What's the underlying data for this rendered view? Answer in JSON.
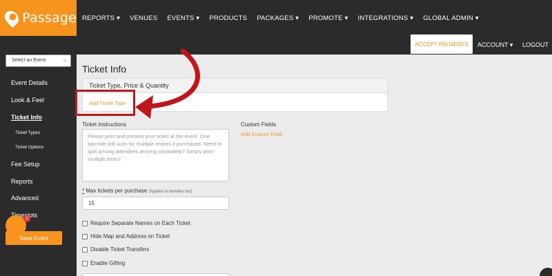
{
  "brand": {
    "name": "Passage",
    "color": "#f7941d"
  },
  "nav": [
    "REPORTS ▾",
    "VENUES",
    "EVENTS ▾",
    "PRODUCTS",
    "PACKAGES ▾",
    "PROMOTE ▾",
    "INTEGRATIONS ▾",
    "GLOBAL ADMIN ▾"
  ],
  "topright": {
    "accept": "ACCEPT PAYMENTS",
    "account": "ACCOUNT ▾",
    "logout": "LOGOUT"
  },
  "sidebar": {
    "select_placeholder": "Select an Event",
    "items": [
      "Event Details",
      "Look & Feel",
      "Ticket Info",
      "Ticket Types",
      "Ticket Options",
      "Fee Setup",
      "Reports",
      "Advanced",
      "Timeslots"
    ],
    "save": "Save Event",
    "chat_badge": "1"
  },
  "main": {
    "title": "Ticket Info",
    "ticket_section": "Ticket Type, Price & Quantity",
    "add_ticket": "Add Ticket Type",
    "instructions_label": "Ticket Instructions",
    "instructions_placeholder": "Please print and present your ticket at the event. One barcode will scan for multiple entries if purchased. Need to split among attendees arriving separately? Simply print multiple times!",
    "custom_fields_label": "Custom Fields",
    "add_custom": "Add Custom Field",
    "max_label": "Max tickets per purchase",
    "max_required": "*",
    "max_note": "(Applies to bundles too)",
    "max_value": "15",
    "checkboxes": [
      "Require Separate Names on Each Ticket",
      "Hide Map and Address on Ticket",
      "Disable Ticket Transfers",
      "Enable Gifting"
    ]
  },
  "annotation_color": "#c0151b"
}
